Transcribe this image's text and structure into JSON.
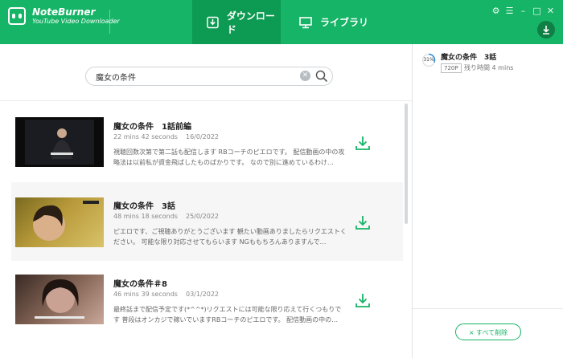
{
  "app": {
    "name": "NoteBurner",
    "subtitle": "YouTube Video Downloader"
  },
  "tabs": [
    {
      "label": "ダウンロード",
      "active": true
    },
    {
      "label": "ライブラリ",
      "active": false
    }
  ],
  "window_controls": [
    "settings",
    "menu",
    "minimize",
    "maximize",
    "close"
  ],
  "search": {
    "value": "魔女の条件"
  },
  "results": [
    {
      "title": "魔女の条件　1話前編",
      "duration": "22 mins 42 seconds",
      "date": "16/0/2022",
      "description": "視聴回数次第で第二話も配信します RBコーチのピエロです。 配信動画の中の攻略法は以前私が資金飛ばしたものばかりです。 なので別に進めているわけ…"
    },
    {
      "title": "魔女の条件　3話",
      "duration": "48 mins 18 seconds",
      "date": "25/0/2022",
      "description": "ピエロです、ご視聴ありがとうございます 観たい動画ありましたらリクエストください。 可能な限り対応させてもらいます NGももちろんありますんで…"
    },
    {
      "title": "魔女の条件＃8",
      "duration": "46 mins 39 seconds",
      "date": "03/1/2022",
      "description": "最終話まで配信予定です(*^^*)リクエストには可能な限り応えて行くつもりです 普段はオンカジで稼いでいますRBコーチのピエロです。 配信動画の中の…"
    }
  ],
  "queue": {
    "title": "魔女の条件　3話",
    "progress_text": "31%",
    "progress": 0.31,
    "quality": "720P",
    "remaining": "残り時間 4 mins"
  },
  "delete_all_label": "× すべて削除",
  "colors": {
    "accent": "#16b466",
    "accent_dark": "#0d9a52"
  }
}
